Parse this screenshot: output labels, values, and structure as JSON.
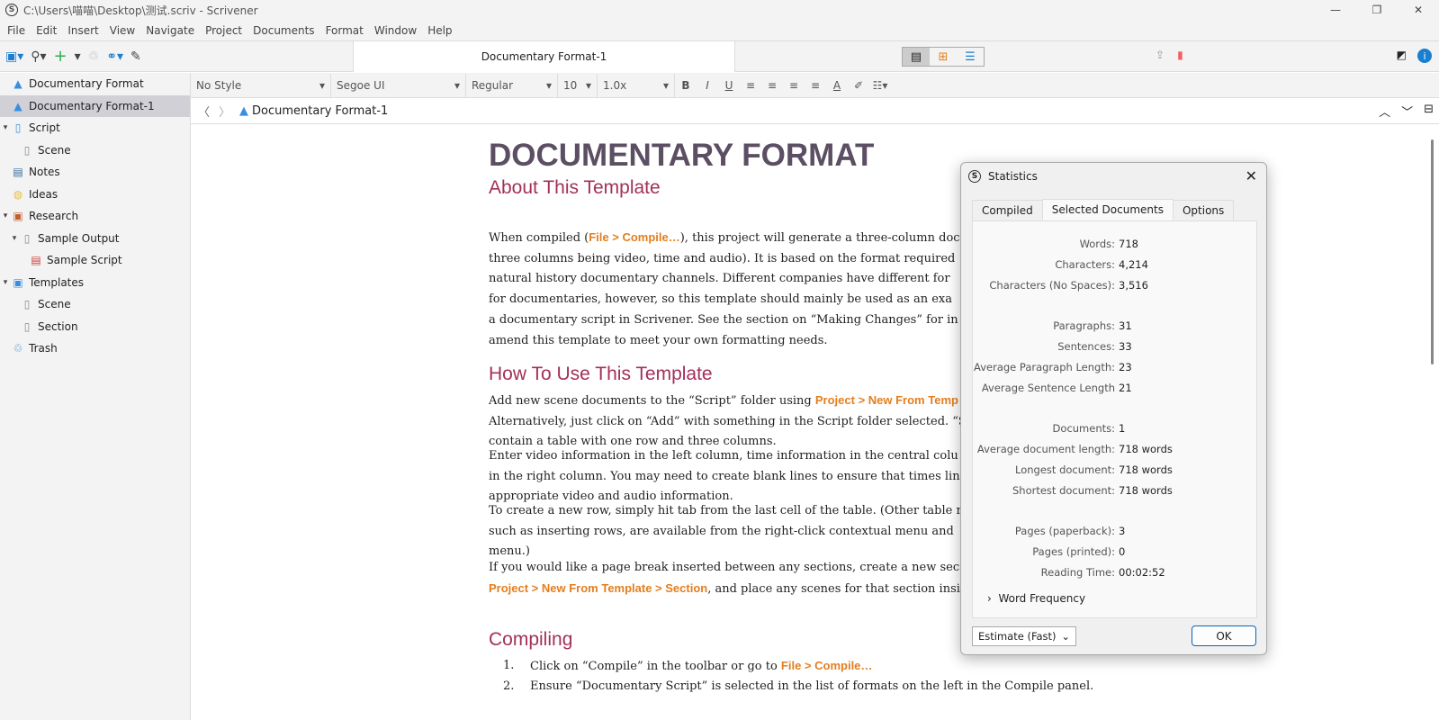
{
  "window": {
    "title": "C:\\Users\\喵喵\\Desktop\\测试.scriv - Scrivener",
    "logo": "S"
  },
  "menu": [
    "File",
    "Edit",
    "Insert",
    "View",
    "Navigate",
    "Project",
    "Documents",
    "Format",
    "Window",
    "Help"
  ],
  "toolbar": {
    "doc_tab": "Documentary Format-1"
  },
  "binder": [
    {
      "label": "Documentary Format",
      "icon": "warning-icon",
      "level": 0,
      "tw": ""
    },
    {
      "label": "Documentary Format-1",
      "icon": "warning-icon",
      "level": 0,
      "tw": "",
      "selected": true
    },
    {
      "label": "Script",
      "icon": "script-icon",
      "level": 0,
      "tw": "▾"
    },
    {
      "label": "Scene",
      "icon": "doc-icon",
      "level": 1,
      "tw": ""
    },
    {
      "label": "Notes",
      "icon": "notes-icon",
      "level": 0,
      "tw": ""
    },
    {
      "label": "Ideas",
      "icon": "lightbulb-icon",
      "level": 0,
      "tw": ""
    },
    {
      "label": "Research",
      "icon": "research-icon",
      "level": 0,
      "tw": "▾"
    },
    {
      "label": "Sample Output",
      "icon": "doc-icon",
      "level": 1,
      "tw": "▾"
    },
    {
      "label": "Sample Script",
      "icon": "pdf-icon",
      "level": 2,
      "tw": ""
    },
    {
      "label": "Templates",
      "icon": "template-icon",
      "level": 0,
      "tw": "▾"
    },
    {
      "label": "Scene",
      "icon": "doc-icon",
      "level": 1,
      "tw": ""
    },
    {
      "label": "Section",
      "icon": "doc-icon",
      "level": 1,
      "tw": ""
    },
    {
      "label": "Trash",
      "icon": "trash-icon",
      "level": 0,
      "tw": ""
    }
  ],
  "format": {
    "style": "No Style",
    "font": "Segoe UI",
    "weight": "Regular",
    "size": "10",
    "spacing": "1.0x"
  },
  "header": {
    "title": "Documentary Format-1"
  },
  "doc": {
    "h1": "DOCUMENTARY FORMAT",
    "sub": "About This Template",
    "p1": [
      "When compiled (",
      "File > Compile…",
      "), this project will generate a three-column doc"
    ],
    "p1b": [
      "three columns being video, time and audio). It is based on the format required",
      "natural history documentary channels. Different companies have different for",
      "for documentaries, however, so this template should mainly be used as an exa",
      "a documentary script in Scrivener. See the section on “Making Changes” for in",
      "amend this template to meet your own formatting needs."
    ],
    "h2": "How To Use This Template",
    "p2a": "Add new scene documents to the “Script” folder using ",
    "p2link": "Project > New From Temp",
    "p2b": [
      "Alternatively, just click on “Add” with something in the Script folder selected. “S",
      "contain a table with one row and three columns."
    ],
    "p3": [
      "Enter video information in the left column, time information in the central colu",
      "in the right column. You may need to create blank lines to ensure that times lin",
      "appropriate video and audio information."
    ],
    "p4": [
      "To create a new row, simply hit tab from the last cell of the table. (Other table r",
      "such as inserting rows, are available from the right-click contextual menu and",
      "menu.)"
    ],
    "p5a": "If you would like a page break inserted between any sections, create a new sec",
    "p5link": "Project > New From Template > Section",
    "p5b": ", and place any scenes for that section insi",
    "h3": "Compiling",
    "li1a": "Click on “Compile” in the toolbar or go to ",
    "li1link": "File > Compile…",
    "li2": "Ensure “Documentary Script” is selected in the list of formats on the left in the Compile panel."
  },
  "stats": {
    "title": "Statistics",
    "tabs": [
      "Compiled",
      "Selected Documents",
      "Options"
    ],
    "rows": [
      {
        "k": "Words:",
        "v": "718"
      },
      {
        "k": "Characters:",
        "v": "4,214"
      },
      {
        "k": "Characters (No Spaces):",
        "v": "3,516"
      },
      {
        "k": "Paragraphs:",
        "v": "31"
      },
      {
        "k": "Sentences:",
        "v": "33"
      },
      {
        "k": "Average Paragraph Length:",
        "v": "23"
      },
      {
        "k": "Average Sentence Length",
        "v": "21"
      },
      {
        "k": "Documents:",
        "v": "1"
      },
      {
        "k": "Average document length:",
        "v": "718 words"
      },
      {
        "k": "Longest document:",
        "v": "718 words"
      },
      {
        "k": "Shortest document:",
        "v": "718 words"
      },
      {
        "k": "Pages (paperback):",
        "v": "3"
      },
      {
        "k": "Pages (printed):",
        "v": "0"
      },
      {
        "k": "Reading Time:",
        "v": "00:02:52"
      }
    ],
    "word_frequency": "Word Frequency",
    "estimate": "Estimate (Fast)",
    "ok": "OK"
  }
}
